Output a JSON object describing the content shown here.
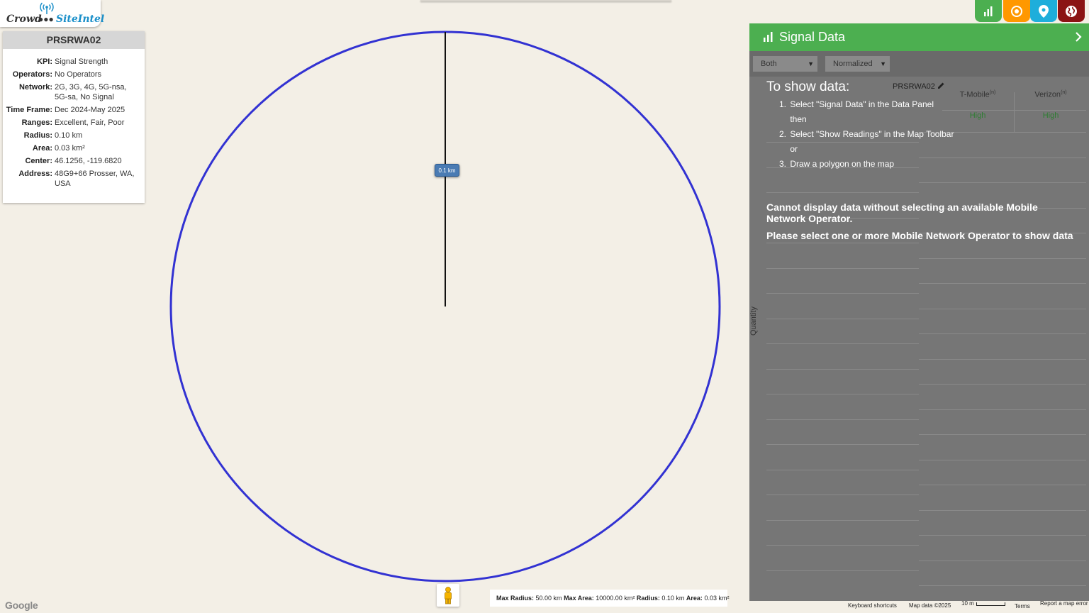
{
  "logo": {
    "word1": "Crowd",
    "word2": "SiteIntel"
  },
  "info": {
    "site_id": "PRSRWA02",
    "rows": [
      {
        "key": "KPI:",
        "value": "Signal Strength"
      },
      {
        "key": "Operators:",
        "value": "No Operators"
      },
      {
        "key": "Network:",
        "value": "2G, 3G, 4G, 5G-nsa, 5G-sa, No Signal"
      },
      {
        "key": "Time Frame:",
        "value": "Dec 2024-May 2025"
      },
      {
        "key": "Ranges:",
        "value": "Excellent, Fair, Poor"
      },
      {
        "key": "Radius:",
        "value": "0.10 km"
      },
      {
        "key": "Area:",
        "value": "0.03 km²"
      },
      {
        "key": "Center:",
        "value": "46.1256, -119.6820"
      },
      {
        "key": "Address:",
        "value": "48G9+66 Prosser, WA, USA"
      }
    ]
  },
  "map": {
    "radius_label": "0.1 km",
    "circle_color": "#3232d2",
    "stats": {
      "max_radius_label": "Max Radius:",
      "max_radius": "50.00 km",
      "max_area_label": "Max Area:",
      "max_area": "10000.00 km²",
      "radius_label": "Radius:",
      "radius": "0.10 km",
      "area_label": "Area:",
      "area": "0.03 km²"
    },
    "google": "Google",
    "footer": {
      "shortcuts": "Keyboard shortcuts",
      "map_data": "Map data ©2025",
      "scale": "10 m",
      "terms": "Terms",
      "report": "Report a map error"
    }
  },
  "toolbar": {
    "buttons": [
      {
        "name": "signal-data",
        "color": "#4caf50"
      },
      {
        "name": "show-readings",
        "color": "#ff9800"
      },
      {
        "name": "place-marker",
        "color": "#1eaedb"
      },
      {
        "name": "globe",
        "color": "#8b1414"
      }
    ]
  },
  "panel": {
    "title": "Signal Data",
    "select_band": "Both",
    "select_mode": "Normalized",
    "show_title": "To show data:",
    "site_id": "PRSRWA02",
    "steps": [
      {
        "num": "1.",
        "text": "Select \"Signal Data\" in the Data Panel"
      },
      {
        "num": "",
        "text": "then"
      },
      {
        "num": "2.",
        "text": "Select \"Show Readings\" in the Map Toolbar"
      },
      {
        "num": "",
        "text": "or"
      },
      {
        "num": "3.",
        "text": "Draw a polygon on the map"
      }
    ],
    "operators": [
      {
        "name": "T-Mobile",
        "sup": "(n)",
        "value": "High"
      },
      {
        "name": "Verizon",
        "sup": "(n)",
        "value": "High"
      }
    ],
    "msg1": "Cannot display data without selecting an available Mobile Network Operator.",
    "msg2": "Please select one or more Mobile Network Operator to show data",
    "y_axis_label": "Quantity"
  }
}
